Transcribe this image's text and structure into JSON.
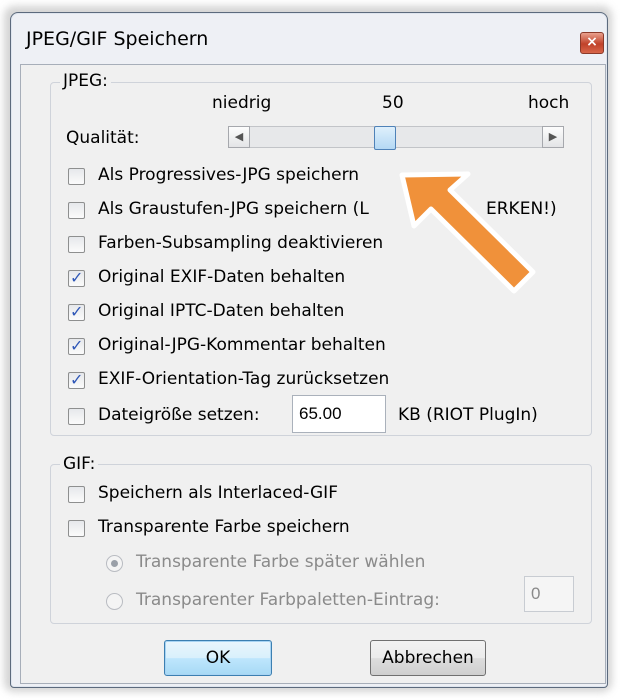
{
  "window": {
    "title": "JPEG/GIF Speichern",
    "close_glyph": "×"
  },
  "jpeg": {
    "legend": "JPEG:",
    "quality": {
      "label": "Qualität:",
      "low_label": "niedrig",
      "high_label": "hoch",
      "value_label": "50",
      "value": 50,
      "min": 0,
      "max": 100,
      "left_glyph": "◀",
      "right_glyph": "▶"
    },
    "options": [
      {
        "label": "Als Progressives-JPG speichern",
        "checked": false
      },
      {
        "label": "Als Graustufen-JPG speichern (L",
        "checked": false
      },
      {
        "label": "Farben-Subsampling deaktivieren",
        "checked": false
      },
      {
        "label": "Original EXIF-Daten behalten",
        "checked": true
      },
      {
        "label": "Original IPTC-Daten behalten",
        "checked": true
      },
      {
        "label": "Original-JPG-Kommentar behalten",
        "checked": true
      },
      {
        "label": "EXIF-Orientation-Tag zurücksetzen",
        "checked": true
      }
    ],
    "graustufen_suffix": "ERKEN!)",
    "filesize": {
      "label": "Dateigröße setzen:",
      "checked": false,
      "value": "65.00",
      "unit": "KB (RIOT PlugIn)"
    }
  },
  "gif": {
    "legend": "GIF:",
    "options": [
      {
        "label": "Speichern als Interlaced-GIF",
        "checked": false
      },
      {
        "label": "Transparente Farbe speichern",
        "checked": false
      }
    ],
    "radios": [
      {
        "label": "Transparente Farbe später wählen",
        "selected": true
      },
      {
        "label": "Transparenter Farbpaletten-Eintrag:",
        "selected": false
      }
    ],
    "palette_entry_value": "0"
  },
  "buttons": {
    "ok": "OK",
    "cancel": "Abbrechen"
  },
  "check_glyph": "✓",
  "colors": {
    "annotation_arrow": "#f0913a",
    "checkbox_check": "#2f57b7"
  }
}
